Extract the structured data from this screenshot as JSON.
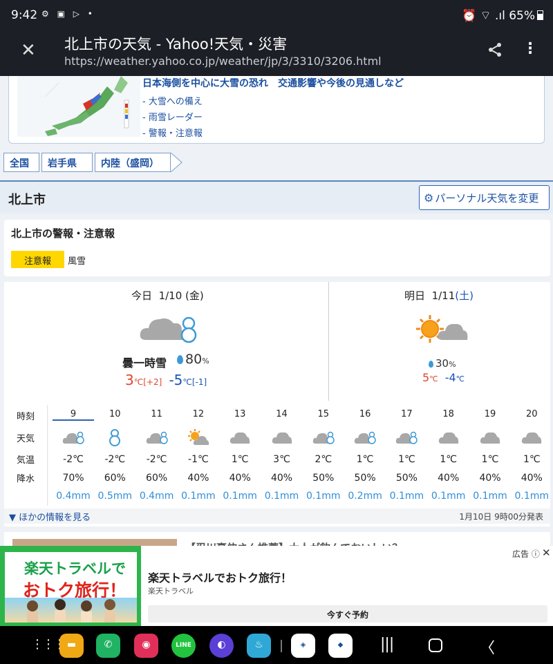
{
  "status": {
    "time": "9:42",
    "icons_left": "⚙ ▣ ▷ •",
    "icons_right": "⏰ ⌔ .ıl",
    "battery": "65%"
  },
  "browser": {
    "title": "北上市の天気 - Yahoo!天気・災害",
    "url": "https://weather.yahoo.co.jp/weather/jp/3/3310/3206.html"
  },
  "news": {
    "headline": "日本海側を中心に大雪の恐れ　交通影響や今後の見通しなど",
    "links": [
      "- 大雪への備え",
      "- 雨雪レーダー",
      "- 警報・注意報"
    ]
  },
  "breadcrumb": [
    "全国",
    "岩手県",
    "内陸（盛岡）"
  ],
  "city": {
    "name": "北上市",
    "personal_button": "パーソナル天気を変更"
  },
  "warning": {
    "title": "北上市の警報・注意報",
    "badge": "注意報",
    "text": "風雪"
  },
  "today": {
    "label": "今日",
    "date": "1/10 (金)",
    "weather": "曇一時雪",
    "pop": "80",
    "pop_unit": "%",
    "high": "3",
    "high_unit": "℃",
    "high_diff": "[+2]",
    "low": "-5",
    "low_unit": "℃",
    "low_diff": "[-1]"
  },
  "tomorrow": {
    "label": "明日",
    "date": "1/11",
    "date_day": "(土)",
    "pop": "30",
    "pop_unit": "%",
    "high": "5",
    "high_unit": "℃",
    "low": "-4",
    "low_unit": "℃"
  },
  "hourly": {
    "labels": {
      "hour": "時刻",
      "weather": "天気",
      "temp": "気温",
      "precip": "降水"
    },
    "items": [
      {
        "hour": "9",
        "icon": "cloud-snow",
        "temp": "-2℃",
        "pop": "70%",
        "mm": "0.4mm"
      },
      {
        "hour": "10",
        "icon": "snow",
        "temp": "-2℃",
        "pop": "60%",
        "mm": "0.5mm"
      },
      {
        "hour": "11",
        "icon": "cloud-snow",
        "temp": "-2℃",
        "pop": "60%",
        "mm": "0.4mm"
      },
      {
        "hour": "12",
        "icon": "sun-cloud",
        "temp": "-1℃",
        "pop": "40%",
        "mm": "0.1mm"
      },
      {
        "hour": "13",
        "icon": "cloud",
        "temp": "1℃",
        "pop": "40%",
        "mm": "0.1mm"
      },
      {
        "hour": "14",
        "icon": "cloud",
        "temp": "3℃",
        "pop": "40%",
        "mm": "0.1mm"
      },
      {
        "hour": "15",
        "icon": "cloud-snow",
        "temp": "2℃",
        "pop": "50%",
        "mm": "0.1mm"
      },
      {
        "hour": "16",
        "icon": "cloud-snow",
        "temp": "1℃",
        "pop": "50%",
        "mm": "0.2mm"
      },
      {
        "hour": "17",
        "icon": "cloud-snow",
        "temp": "1℃",
        "pop": "50%",
        "mm": "0.1mm"
      },
      {
        "hour": "18",
        "icon": "cloud",
        "temp": "1℃",
        "pop": "40%",
        "mm": "0.1mm"
      },
      {
        "hour": "19",
        "icon": "cloud",
        "temp": "1℃",
        "pop": "40%",
        "mm": "0.1mm"
      },
      {
        "hour": "20",
        "icon": "cloud",
        "temp": "1℃",
        "pop": "40%",
        "mm": "0.1mm"
      }
    ]
  },
  "more": {
    "link": "▼ ほかの情報を見る",
    "issued": "1月10日 9時00分発表"
  },
  "article": {
    "text": "【忍川豪伸さん推薦】大人が飲んでおいしい？"
  },
  "ad": {
    "banner_line1": "楽天トラベルで",
    "banner_line2": "おトク旅行！",
    "title": "楽天トラベルでおトク旅行！",
    "source": "楽天トラベル",
    "button": "今すぐ予約",
    "label": "広告 ⓘ",
    "close": "✕"
  },
  "colors": {
    "accent": "#2d62b0",
    "link": "#1a4fa0",
    "high": "#e0452a",
    "low": "#1a54b8",
    "mm": "#2f8ed8",
    "warning_badge": "#ffd700"
  }
}
